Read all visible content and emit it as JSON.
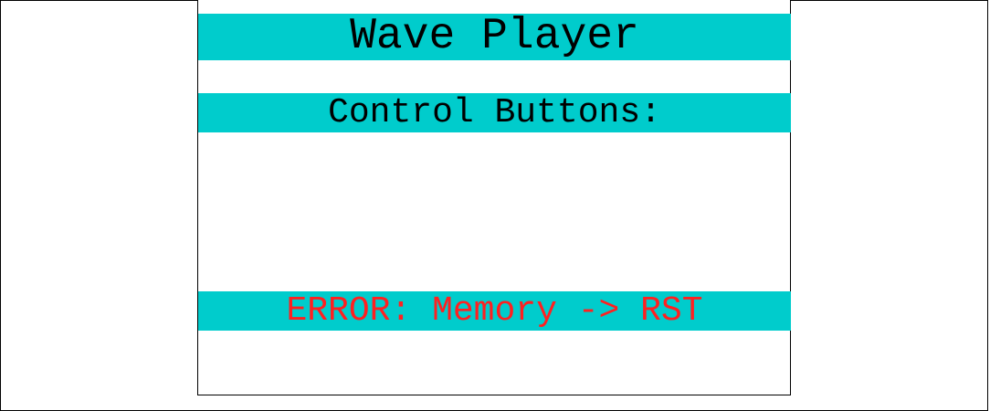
{
  "app": {
    "title": "Wave Player"
  },
  "display": {
    "subtitle": "Control Buttons:",
    "status_message": "ERROR: Memory -> RST"
  },
  "colors": {
    "bar_background": "#00cccc",
    "text": "#000000",
    "error_text": "#ff2020",
    "screen_background": "#ffffff"
  }
}
